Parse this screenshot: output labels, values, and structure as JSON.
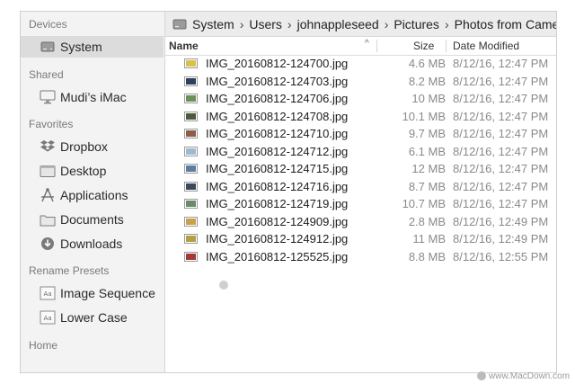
{
  "sidebar": {
    "sections": [
      {
        "title": "Devices",
        "items": [
          {
            "label": "System",
            "icon": "hard-drive-icon",
            "selected": true
          }
        ]
      },
      {
        "title": "Shared",
        "items": [
          {
            "label": "Mudi’s iMac",
            "icon": "imac-icon"
          }
        ]
      },
      {
        "title": "Favorites",
        "items": [
          {
            "label": "Dropbox",
            "icon": "dropbox-icon"
          },
          {
            "label": "Desktop",
            "icon": "desktop-folder-icon"
          },
          {
            "label": "Applications",
            "icon": "applications-icon"
          },
          {
            "label": "Documents",
            "icon": "documents-folder-icon"
          },
          {
            "label": "Downloads",
            "icon": "downloads-icon"
          }
        ]
      },
      {
        "title": "Rename Presets",
        "items": [
          {
            "label": "Image Sequence",
            "icon": "preset-icon"
          },
          {
            "label": "Lower Case",
            "icon": "preset-icon"
          }
        ]
      },
      {
        "title": "Home",
        "items": []
      }
    ]
  },
  "path": {
    "crumbs": [
      "System",
      "Users",
      "johnappleseed",
      "Pictures",
      "Photos from Camera"
    ],
    "separator": "›"
  },
  "columns": {
    "name": "Name",
    "sort_indicator": "^",
    "size": "Size",
    "date": "Date Modified"
  },
  "files": [
    {
      "name": "IMG_20160812-124700.jpg",
      "size": "4.6 MB",
      "date": "8/12/16, 12:47 PM",
      "thumb": "#d8c24a"
    },
    {
      "name": "IMG_20160812-124703.jpg",
      "size": "8.2 MB",
      "date": "8/12/16, 12:47 PM",
      "thumb": "#2e3f5c"
    },
    {
      "name": "IMG_20160812-124706.jpg",
      "size": "10 MB",
      "date": "8/12/16, 12:47 PM",
      "thumb": "#6f8f5a"
    },
    {
      "name": "IMG_20160812-124708.jpg",
      "size": "10.1 MB",
      "date": "8/12/16, 12:47 PM",
      "thumb": "#4d5b3c"
    },
    {
      "name": "IMG_20160812-124710.jpg",
      "size": "9.7 MB",
      "date": "8/12/16, 12:47 PM",
      "thumb": "#8c5d4a"
    },
    {
      "name": "IMG_20160812-124712.jpg",
      "size": "6.1 MB",
      "date": "8/12/16, 12:47 PM",
      "thumb": "#9fbad0"
    },
    {
      "name": "IMG_20160812-124715.jpg",
      "size": "12 MB",
      "date": "8/12/16, 12:47 PM",
      "thumb": "#5c7d9e"
    },
    {
      "name": "IMG_20160812-124716.jpg",
      "size": "8.7 MB",
      "date": "8/12/16, 12:47 PM",
      "thumb": "#3a4a5a"
    },
    {
      "name": "IMG_20160812-124719.jpg",
      "size": "10.7 MB",
      "date": "8/12/16, 12:47 PM",
      "thumb": "#6a8a6a"
    },
    {
      "name": "IMG_20160812-124909.jpg",
      "size": "2.8 MB",
      "date": "8/12/16, 12:49 PM",
      "thumb": "#c9a24f"
    },
    {
      "name": "IMG_20160812-124912.jpg",
      "size": "11 MB",
      "date": "8/12/16, 12:49 PM",
      "thumb": "#b3a046"
    },
    {
      "name": "IMG_20160812-125525.jpg",
      "size": "8.8 MB",
      "date": "8/12/16, 12:55 PM",
      "thumb": "#a33a3a"
    }
  ],
  "watermark": "www.MacDown.com"
}
